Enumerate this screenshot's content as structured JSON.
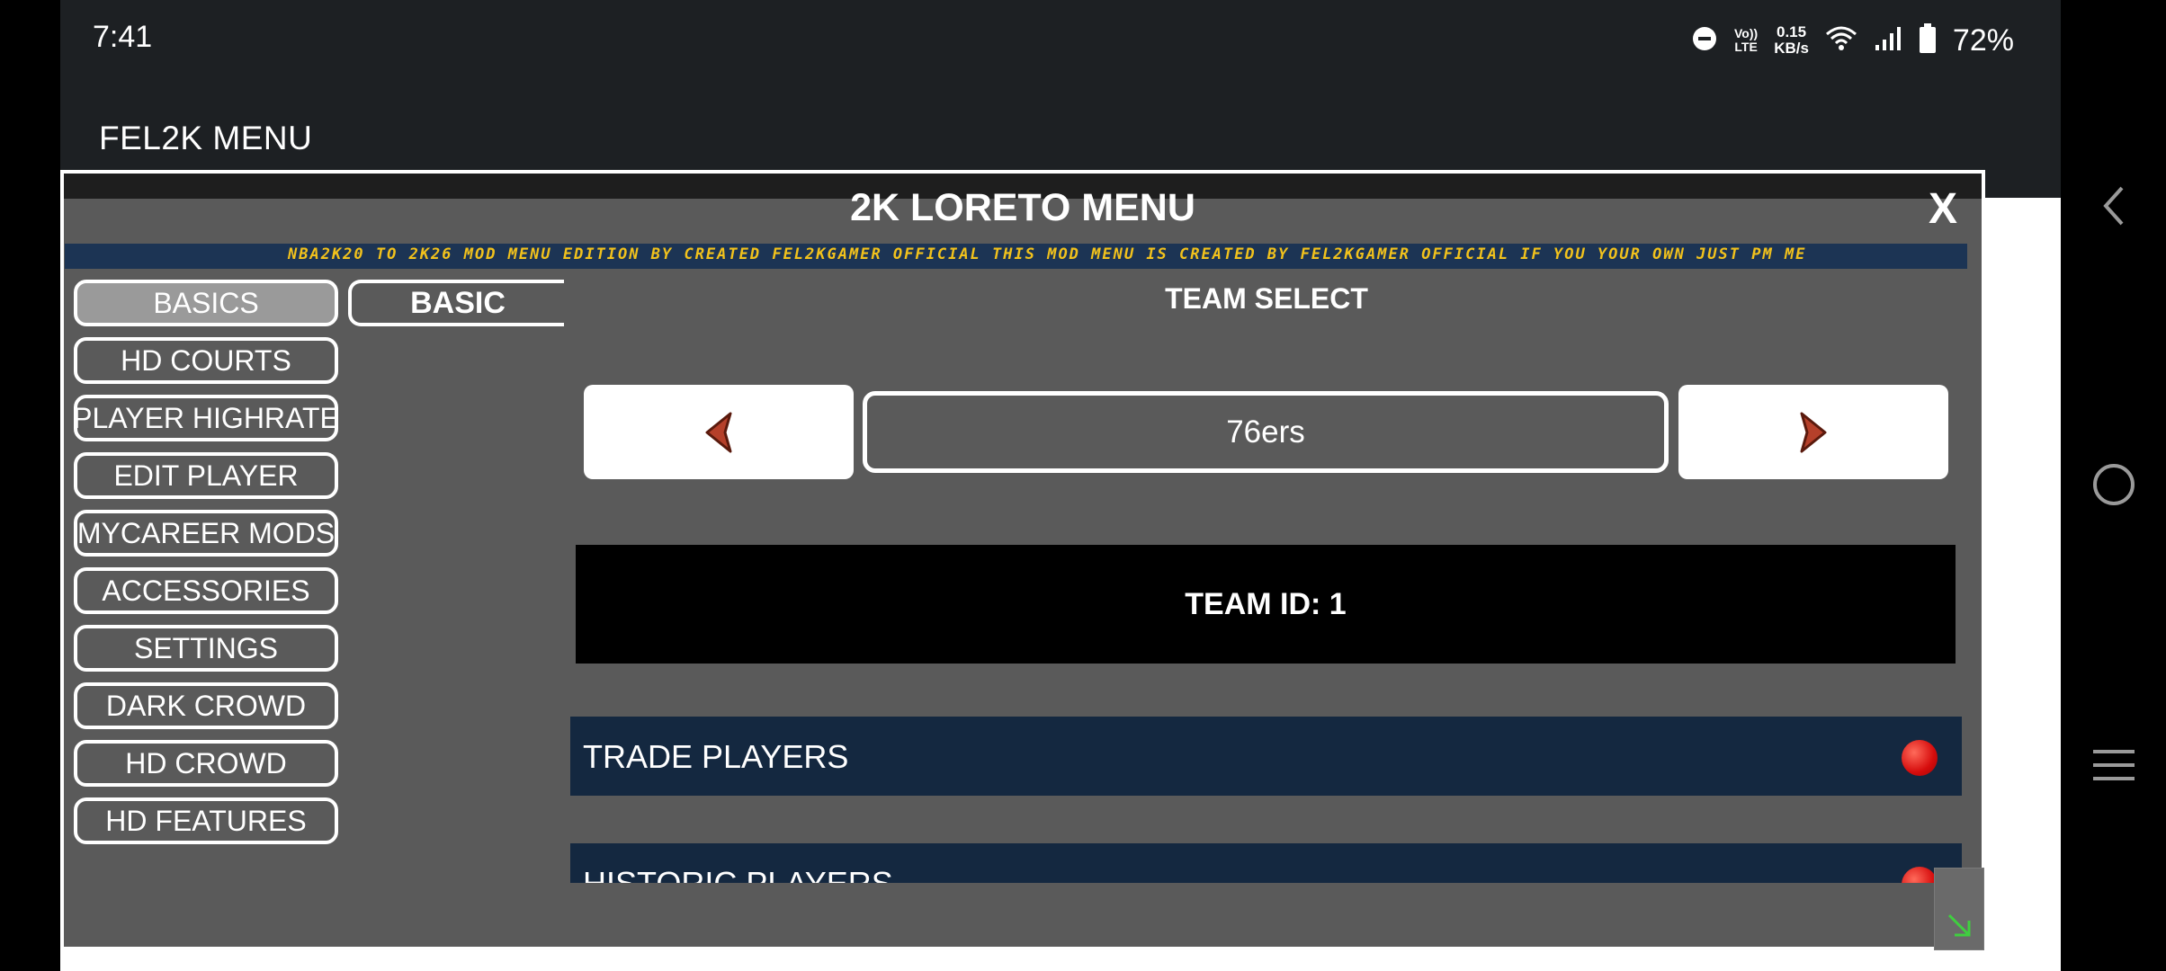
{
  "status_bar": {
    "time": "7:41",
    "volte_top": "Vo))",
    "volte_bottom": "LTE",
    "speed_value": "0.15",
    "speed_unit": "KB/s",
    "battery": "72%"
  },
  "app_title": "FEL2K MENU",
  "menu": {
    "title": "2K LORETO MENU",
    "close_label": "X",
    "marquee": "NBA2K20 TO 2K26 MOD MENU EDITION BY CREATED FEL2KGAMER OFFICIAL  THIS MOD MENU IS CREATED BY FEL2KGAMER OFFICIAL IF YOU YOUR OWN JUST PM ME",
    "sidebar": [
      {
        "label": "BASICS"
      },
      {
        "label": "HD COURTS"
      },
      {
        "label": "PLAYER HIGHRATE"
      },
      {
        "label": "EDIT PLAYER"
      },
      {
        "label": "MYCAREER MODS"
      },
      {
        "label": "ACCESSORIES"
      },
      {
        "label": "SETTINGS"
      },
      {
        "label": "DARK CROWD"
      },
      {
        "label": "HD CROWD"
      },
      {
        "label": "HD FEATURES"
      }
    ],
    "active_tab": "BASIC",
    "team_select_label": "TEAM SELECT",
    "team_name": "76ers",
    "team_id_text": "TEAM ID: 1",
    "features": [
      {
        "label": "TRADE PLAYERS",
        "state": "off"
      },
      {
        "label": "HISTORIC PLAYERS",
        "state": "off"
      }
    ]
  },
  "icons": {
    "back": "chevron-left-icon",
    "home": "circle-home-icon",
    "recents": "hamburger-icon",
    "prev": "arrow-left-icon",
    "next": "arrow-right-icon",
    "resize": "resize-arrow-icon"
  },
  "colors": {
    "menu_bg": "#5a5a5a",
    "marquee_bg": "#1c3454",
    "marquee_text": "#f2c21c",
    "feature_row_bg": "#142840",
    "toggle_off": "#e01010",
    "resize_accent": "#3fcf3f"
  }
}
